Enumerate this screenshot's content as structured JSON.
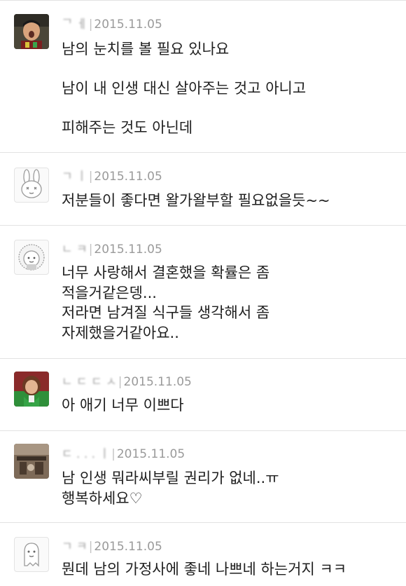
{
  "comments": [
    {
      "nick": "ᄀ  ㅔ",
      "date": "2015.11.05",
      "lines": [
        "남의 눈치를 볼 필요 있나요",
        "",
        "남이 내 인생 대신 살아주는 것고 아니고",
        "",
        "피해주는 것도 아닌데"
      ]
    },
    {
      "nick": "ㄱ     ㅣ",
      "date": "2015.11.05",
      "lines": [
        "저분들이 좋다면 왈가왈부할 필요없을듯~~"
      ]
    },
    {
      "nick": "ㄴ            ㅋ",
      "date": "2015.11.05",
      "lines": [
        "너무 사랑해서 결혼했을 확률은 좀",
        "적을거같은뎅...",
        "저라면 남겨질 식구들 생각해서 좀",
        "자제했을거같아요.."
      ]
    },
    {
      "nick": "ㄴ ㄷ ㄷ ㅅ",
      "date": "2015.11.05",
      "lines": [
        "아 애기 너무 이쁘다"
      ]
    },
    {
      "nick": "ㄷ . . . ㅣ",
      "date": "2015.11.05",
      "lines": [
        "남 인생 뭐라씨부릴 권리가 없네..ㅠ",
        "행복하세요♡"
      ]
    },
    {
      "nick": "ㄱ ㅋ",
      "date": "2015.11.05",
      "lines": [
        "뭔데 남의 가정사에 좋네 나쁘네 하는거지 ㅋㅋ"
      ]
    }
  ],
  "avatars": [
    "man-shouting-photo",
    "rabbit-character-icon",
    "lion-character-icon",
    "girl-green-jacket-photo",
    "desk-photo",
    "ghost-character-icon"
  ],
  "colors": {
    "divider": "#e2e2e2",
    "meta_text": "#9a9a9a",
    "body_text": "#1e1e1e"
  }
}
